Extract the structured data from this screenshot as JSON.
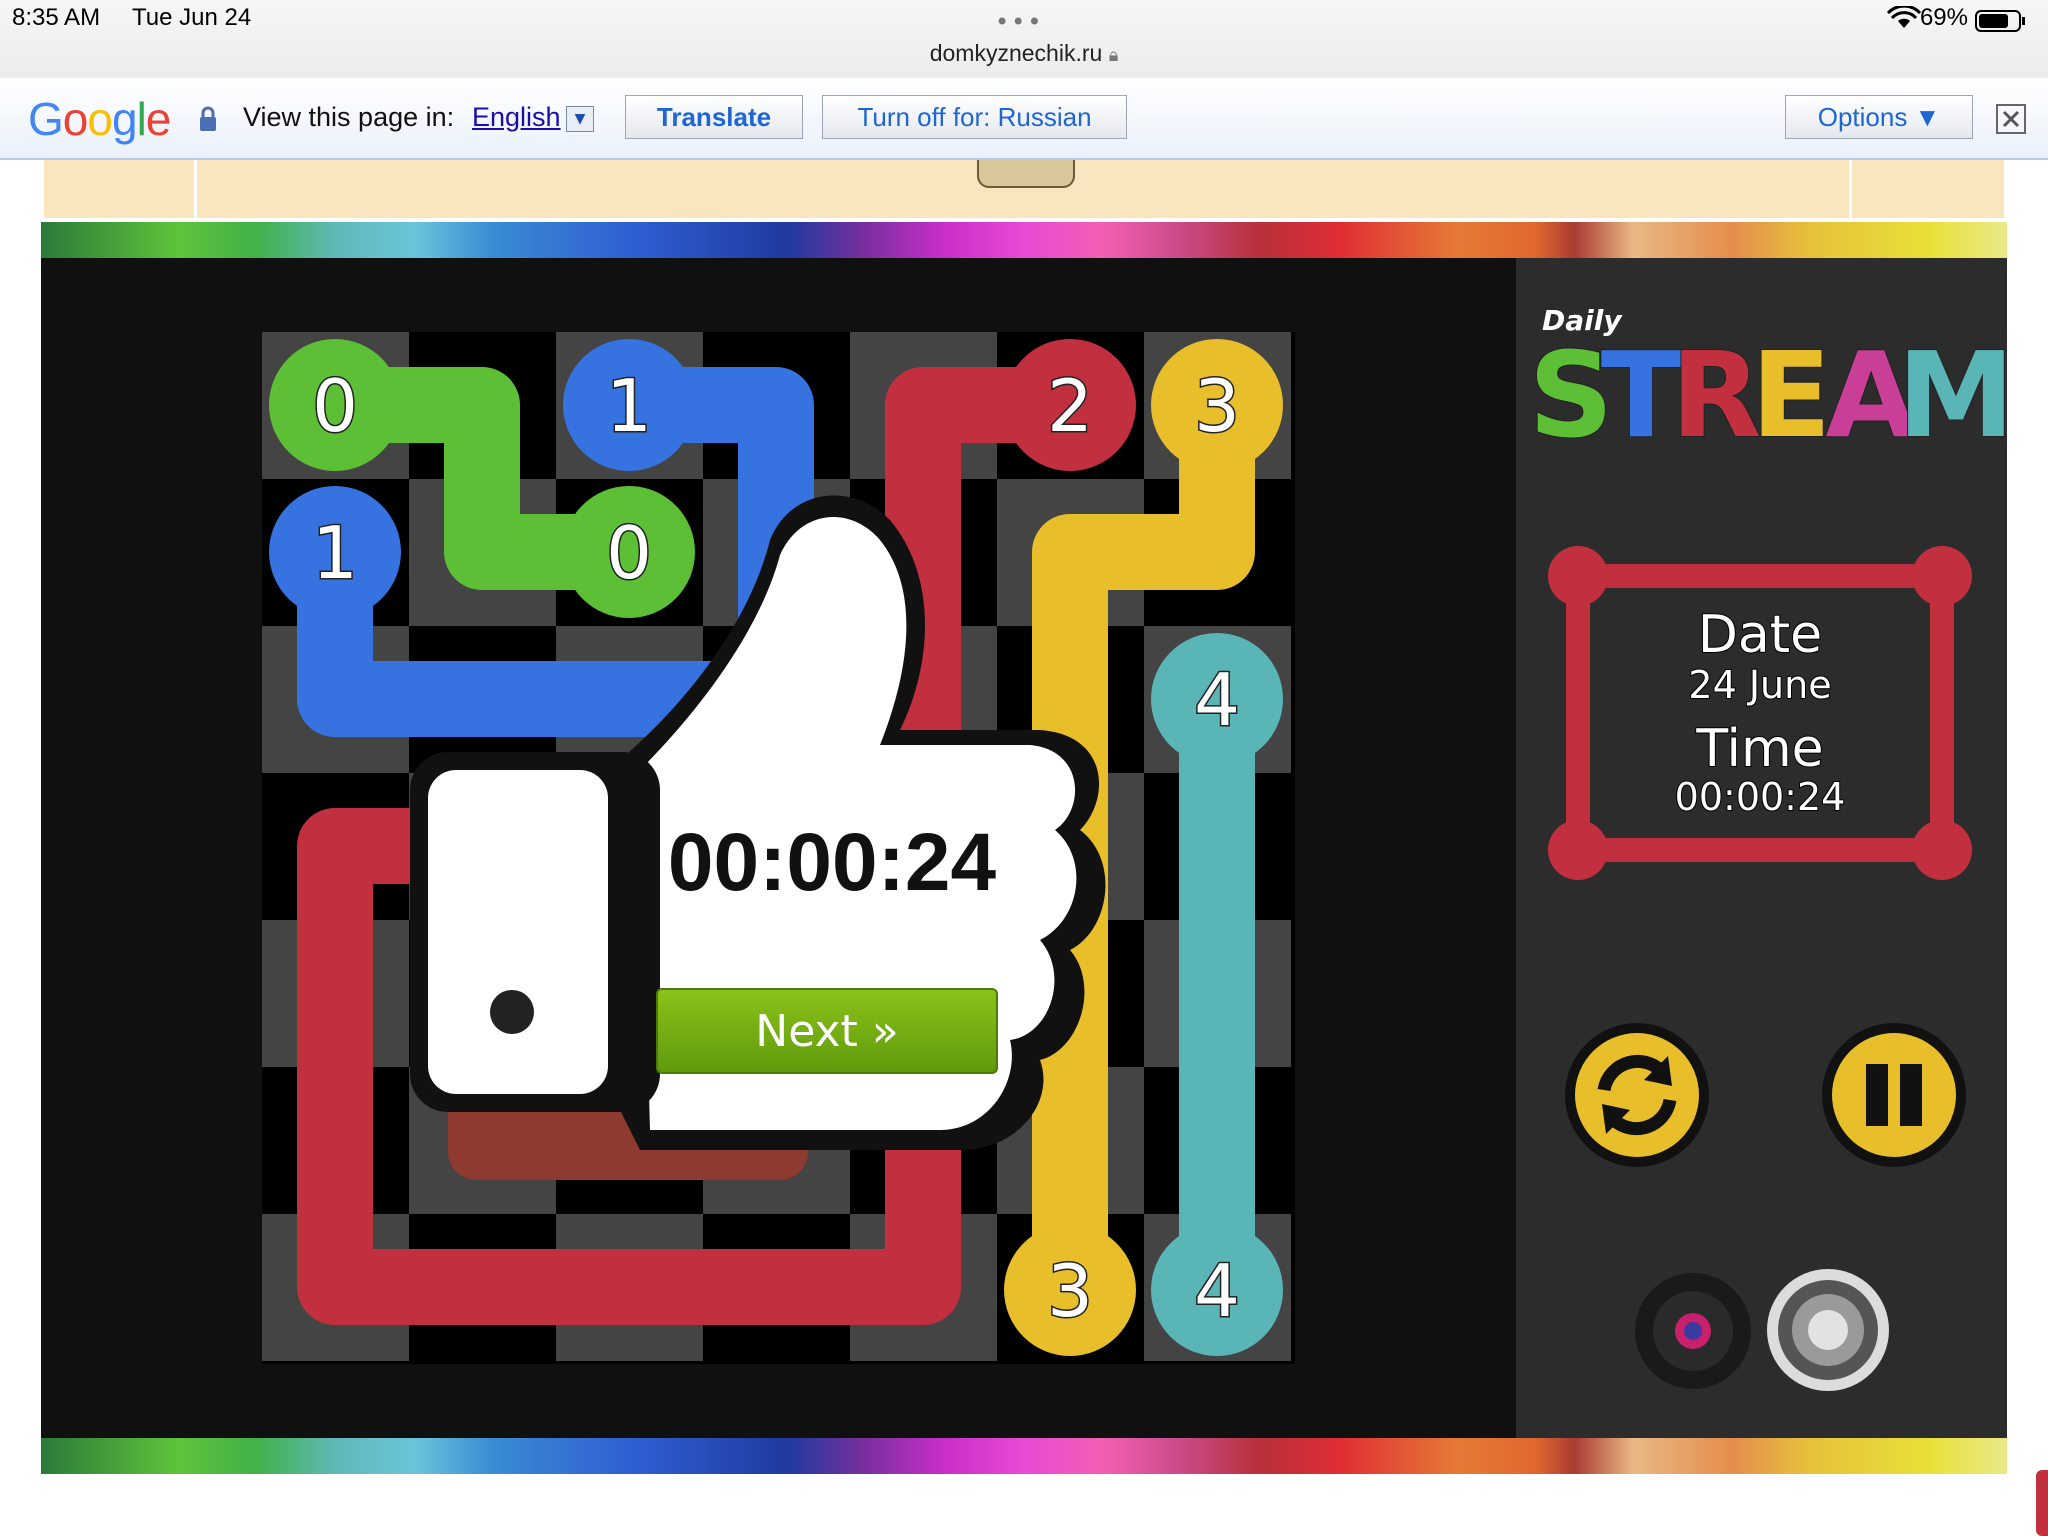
{
  "status_bar": {
    "time": "8:35 AM",
    "date": "Tue Jun 24",
    "url": "domkyznechik.ru",
    "battery": "69%"
  },
  "translate_bar": {
    "logo": "Google",
    "prompt": "View this page in:",
    "language": "English",
    "translate_label": "Translate",
    "turn_off_label": "Turn off for: Russian",
    "options_label": "Options ▼",
    "close_icon": "close-icon"
  },
  "board": {
    "endpoints": [
      "0",
      "1",
      "2",
      "3",
      "1",
      "0",
      "4",
      "3",
      "4"
    ],
    "colors": {
      "green": "#5dbf35",
      "blue": "#3673e0",
      "red": "#c2303f",
      "yellow": "#e8be2a",
      "teal": "#5ab6b6"
    }
  },
  "popup": {
    "time": "00:00:24",
    "next_label": "Next »"
  },
  "sidebar": {
    "logo_small": "Daily",
    "logo_letters": [
      "S",
      "T",
      "R",
      "E",
      "A",
      "M"
    ],
    "date_label": "Date",
    "date_value": "24 June",
    "time_label": "Time",
    "time_value": "00:00:24"
  },
  "controls": [
    "refresh-icon",
    "pause-icon",
    "record-icon",
    "speaker-icon"
  ]
}
